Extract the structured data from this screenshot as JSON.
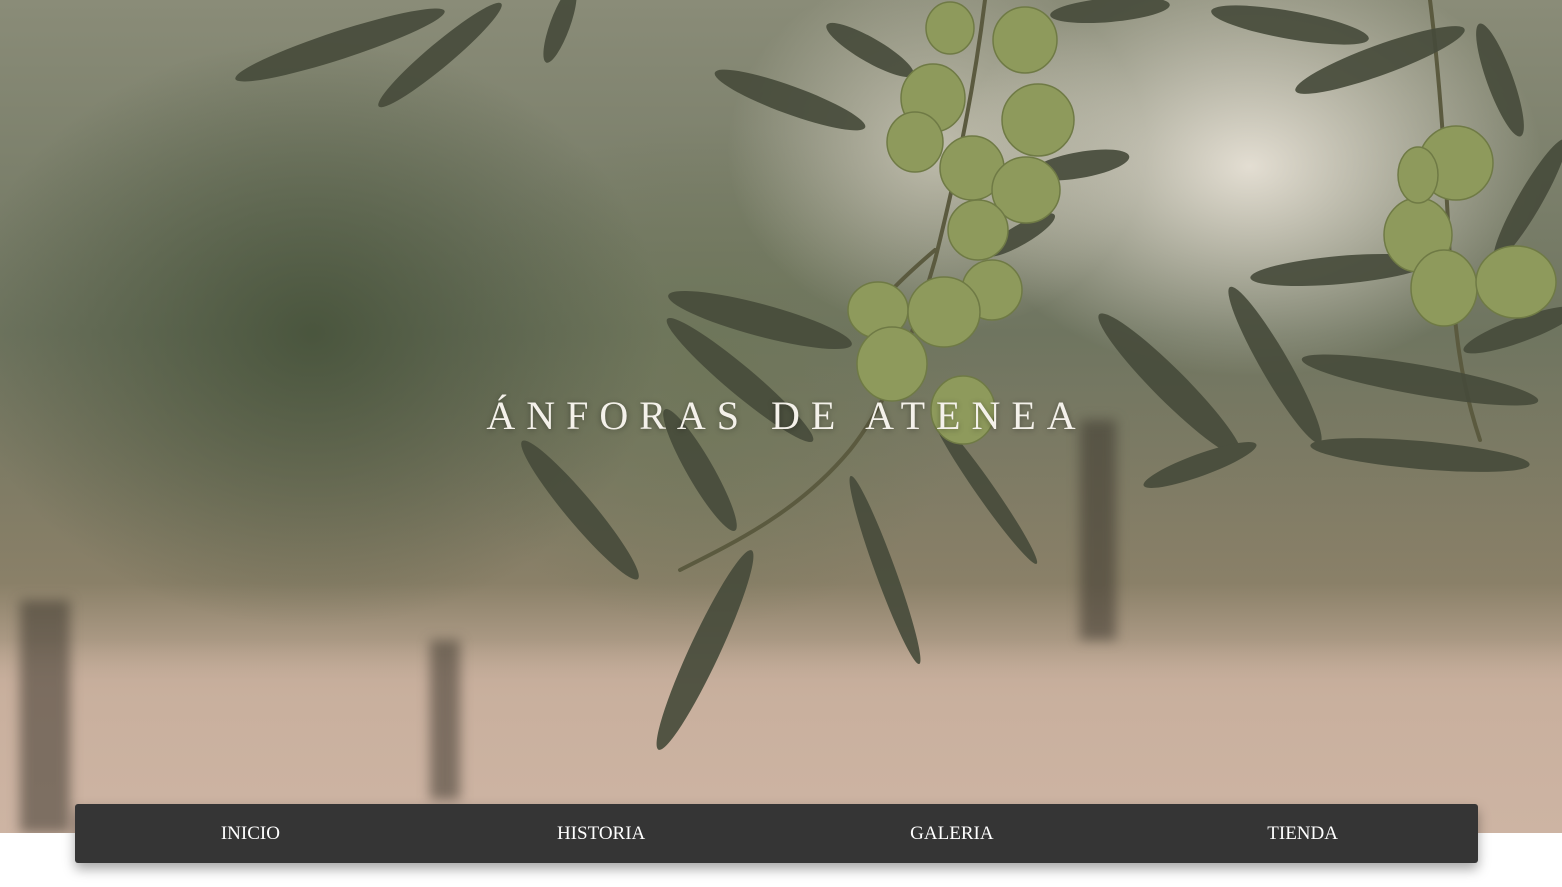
{
  "hero": {
    "title": "ÁNFORAS DE ATENEA"
  },
  "nav": {
    "items": [
      {
        "label": "INICIO"
      },
      {
        "label": "HISTORIA"
      },
      {
        "label": "GALERIA"
      },
      {
        "label": "TIENDA"
      }
    ]
  },
  "colors": {
    "navbar_bg": "#353535",
    "nav_text": "#ffffff",
    "title_text": "#f4f1ea",
    "olive": "#8d9a5a",
    "leaf": "#4a4f3e"
  }
}
